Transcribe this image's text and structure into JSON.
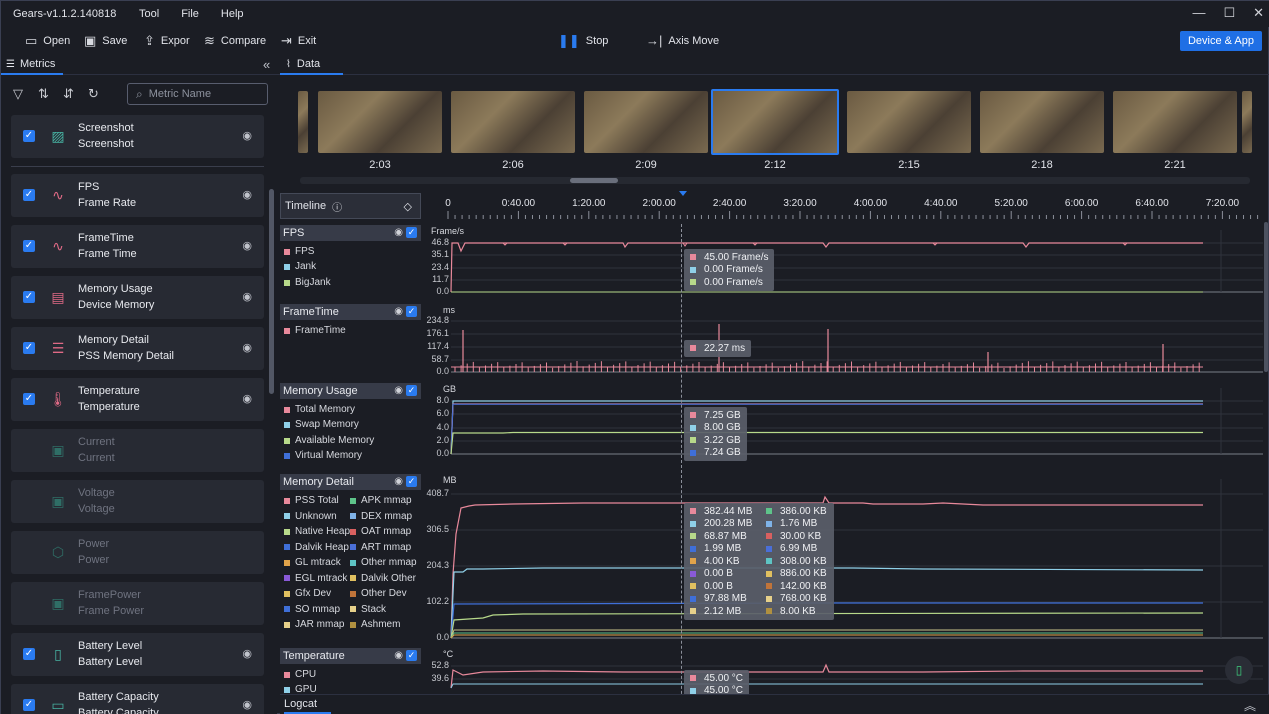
{
  "app": {
    "title": "Gears-v1.1.2.140818"
  },
  "menu": [
    "Tool",
    "File",
    "Help"
  ],
  "window_buttons": [
    "—",
    "☐",
    "✕"
  ],
  "toolbar": {
    "open": "Open",
    "save": "Save",
    "export": "Expor",
    "compare": "Compare",
    "exit": "Exit",
    "stop": "Stop",
    "axis_move": "Axis Move",
    "device_app": "Device & App"
  },
  "tabs": {
    "metrics": "Metrics",
    "data": "Data"
  },
  "search": {
    "placeholder": "Metric Name"
  },
  "metrics": [
    {
      "title": "Screenshot",
      "subtitle": "Screenshot",
      "checked": true,
      "icon": "image-icon"
    },
    {
      "title": "FPS",
      "subtitle": "Frame Rate",
      "checked": true,
      "icon": "fps-icon"
    },
    {
      "title": "FrameTime",
      "subtitle": "Frame Time",
      "checked": true,
      "icon": "frametime-icon"
    },
    {
      "title": "Memory Usage",
      "subtitle": "Device Memory",
      "checked": true,
      "icon": "memory-icon"
    },
    {
      "title": "Memory Detail",
      "subtitle": "PSS Memory Detail",
      "checked": true,
      "icon": "list-icon"
    },
    {
      "title": "Temperature",
      "subtitle": "Temperature",
      "checked": true,
      "icon": "thermometer-icon"
    },
    {
      "title": "Current",
      "subtitle": "Current",
      "checked": false,
      "icon": "current-icon"
    },
    {
      "title": "Voltage",
      "subtitle": "Voltage",
      "checked": false,
      "icon": "voltage-icon"
    },
    {
      "title": "Power",
      "subtitle": "Power",
      "checked": false,
      "icon": "power-icon"
    },
    {
      "title": "FramePower",
      "subtitle": "Frame Power",
      "checked": false,
      "icon": "framepower-icon"
    },
    {
      "title": "Battery Level",
      "subtitle": "Battery Level",
      "checked": true,
      "icon": "battery-level-icon"
    },
    {
      "title": "Battery Capacity",
      "subtitle": "Battery Capacity",
      "checked": true,
      "icon": "battery-capacity-icon"
    }
  ],
  "thumbnails": [
    "2:03",
    "2:06",
    "2:09",
    "2:12",
    "2:15",
    "2:18",
    "2:21"
  ],
  "timeline": {
    "label": "Timeline",
    "ticks": [
      "0",
      "0:40.00",
      "1:20.00",
      "2:00.00",
      "2:40.00",
      "3:20.00",
      "4:00.00",
      "4:40.00",
      "5:20.00",
      "6:00.00",
      "6:40.00",
      "7:20.00"
    ]
  },
  "colors": {
    "accent": "#2a7bf0",
    "pink": "#e8899b",
    "lightblue": "#8fd0e8",
    "green": "#b7d98a",
    "blue": "#3f6fd8"
  },
  "panels": {
    "fps": {
      "title": "FPS",
      "unit": "Frame/s",
      "legend": [
        "FPS",
        "Jank",
        "BigJank"
      ],
      "yticks": [
        "46.8",
        "35.1",
        "23.4",
        "11.7",
        "0.0"
      ],
      "tooltip": [
        "45.00  Frame/s",
        "0.00  Frame/s",
        "0.00  Frame/s"
      ]
    },
    "frametime": {
      "title": "FrameTime",
      "unit": "ms",
      "legend": [
        "FrameTime"
      ],
      "yticks": [
        "234.8",
        "176.1",
        "117.4",
        "58.7",
        "0.0"
      ],
      "tooltip": [
        "22.27  ms"
      ]
    },
    "memusage": {
      "title": "Memory Usage",
      "unit": "GB",
      "legend": [
        "Total Memory",
        "Swap Memory",
        "Available Memory",
        "Virtual Memory"
      ],
      "yticks": [
        "8.0",
        "6.0",
        "4.0",
        "2.0",
        "0.0"
      ],
      "tooltip": [
        "7.25  GB",
        "8.00  GB",
        "3.22  GB",
        "7.24  GB"
      ]
    },
    "memdetail": {
      "title": "Memory Detail",
      "unit": "MB",
      "legend_left": [
        "PSS Total",
        "Unknown",
        "Native Heap",
        "Dalvik Heap",
        "GL mtrack",
        "EGL mtrack",
        "Gfx Dev",
        "SO mmap",
        "JAR mmap"
      ],
      "legend_right": [
        "APK mmap",
        "DEX mmap",
        "OAT mmap",
        "ART mmap",
        "Other mmap",
        "Dalvik Other",
        "Other Dev",
        "Stack",
        "Ashmem"
      ],
      "yticks": [
        "408.7",
        "306.5",
        "204.3",
        "102.2",
        "0.0"
      ],
      "tooltip_left": [
        "382.44  MB",
        "200.28  MB",
        "68.87  MB",
        "1.99  MB",
        "4.00  KB",
        "0.00  B",
        "0.00  B",
        "97.88  MB",
        "2.12  MB"
      ],
      "tooltip_right": [
        "386.00  KB",
        "1.76  MB",
        "30.00  KB",
        "6.99  MB",
        "308.00  KB",
        "886.00  KB",
        "142.00  KB",
        "768.00  KB",
        "8.00  KB"
      ]
    },
    "temperature": {
      "title": "Temperature",
      "unit": "°C",
      "legend": [
        "CPU",
        "GPU"
      ],
      "yticks": [
        "52.8",
        "39.6"
      ],
      "tooltip": [
        "45.00  °C",
        "45.00  °C"
      ]
    }
  },
  "logcat": {
    "label": "Logcat"
  }
}
